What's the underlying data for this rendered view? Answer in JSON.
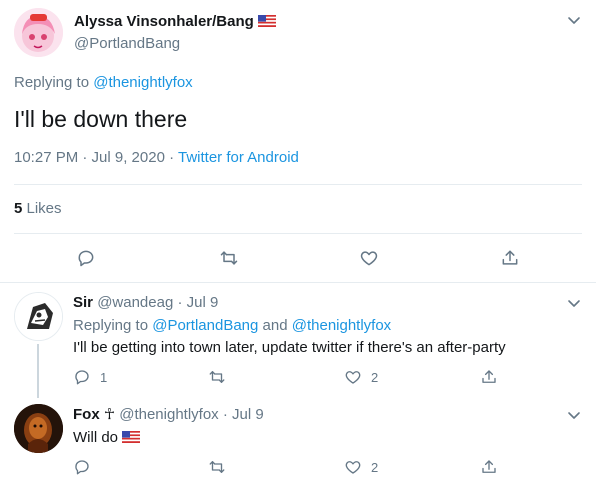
{
  "main_tweet": {
    "author_name": "Alyssa Vinsonhaler/Bang",
    "author_handle": "@PortlandBang",
    "replying_prefix": "Replying to ",
    "replying_to": "@thenightlyfox",
    "text": "I'll be down there",
    "time": "10:27 PM · Jul 9, 2020 · ",
    "source": "Twitter for Android",
    "likes_count": "5",
    "likes_label": " Likes"
  },
  "reply1": {
    "author_name": "Sir",
    "author_handle": "@wandeag",
    "date": " · Jul 9",
    "replying_prefix": "Replying to ",
    "replying_to_1": "@PortlandBang",
    "replying_and": " and ",
    "replying_to_2": "@thenightlyfox",
    "text": "I'll be getting into town later, update twitter if there's an after-party",
    "reply_count": "1",
    "like_count": "2"
  },
  "reply2": {
    "author_name": "Fox",
    "name_glyph": "☥",
    "author_handle": "@thenightlyfox",
    "date": " · Jul 9",
    "text": "Will do",
    "like_count": "2"
  },
  "colors": {
    "link": "#1b95e0",
    "muted": "#657786",
    "divider": "#e6ecf0",
    "text": "#14171a"
  }
}
